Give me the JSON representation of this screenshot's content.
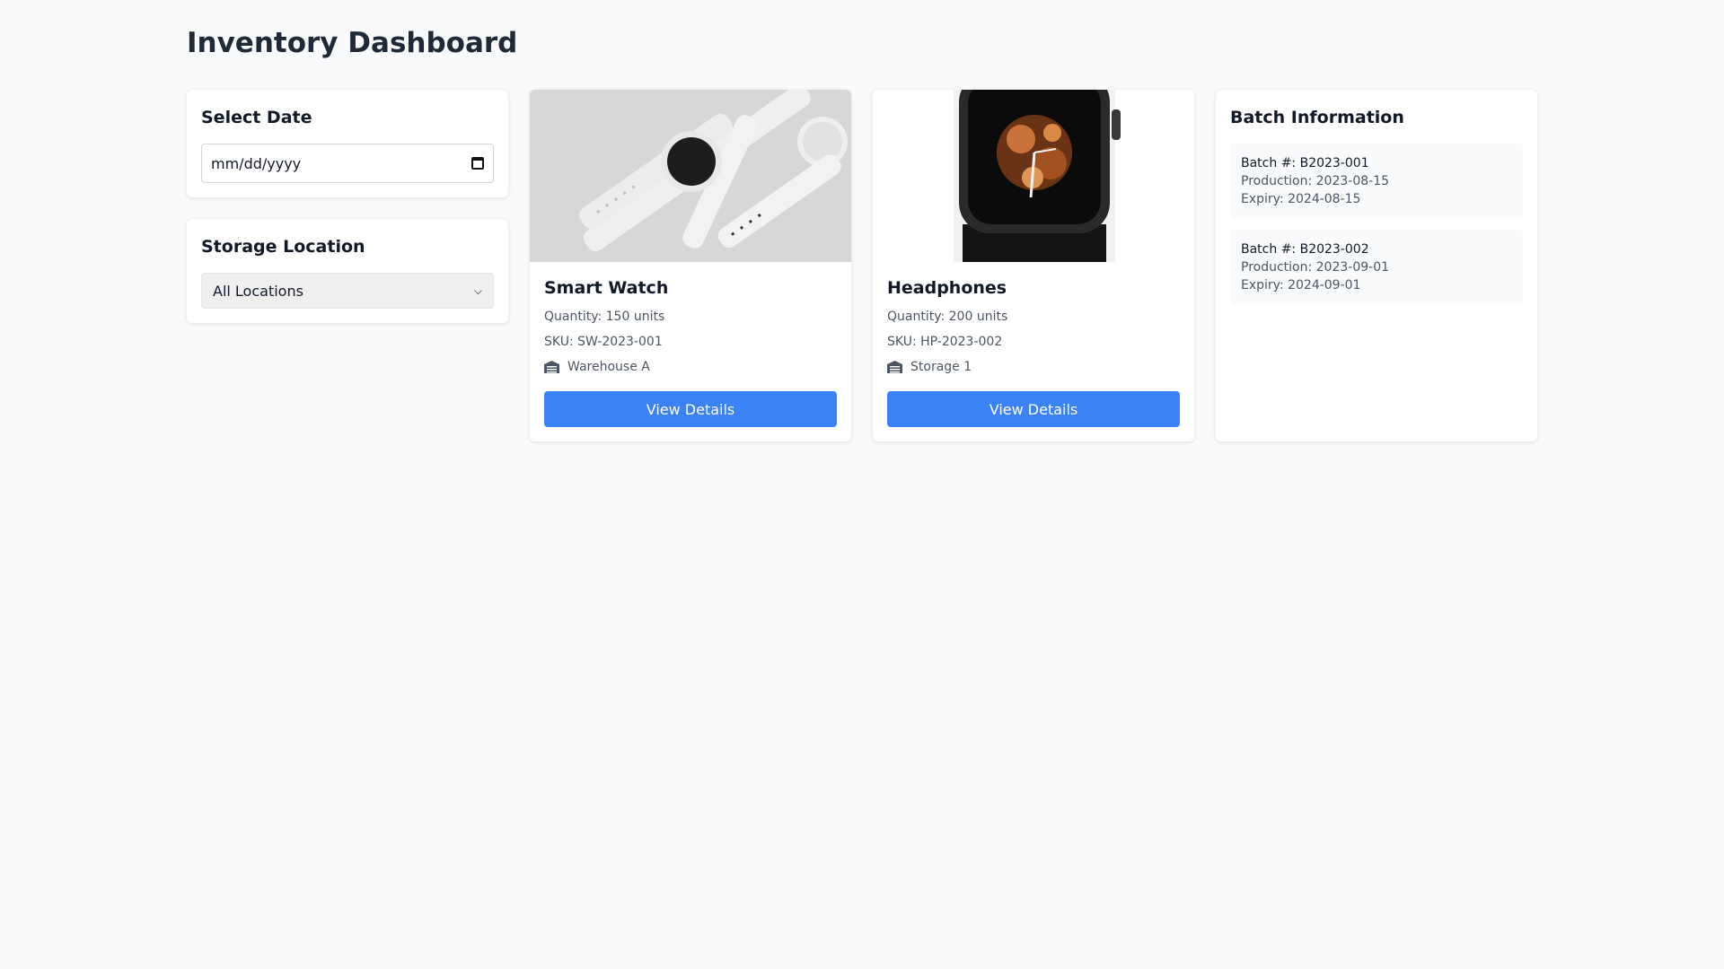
{
  "page": {
    "title": "Inventory Dashboard"
  },
  "date_filter": {
    "title": "Select Date",
    "placeholder": "mm/dd/yyyy"
  },
  "location_filter": {
    "title": "Storage Location",
    "selected": "All Locations"
  },
  "products": [
    {
      "name": "Smart Watch",
      "quantity": "Quantity: 150 units",
      "sku": "SKU: SW-2023-001",
      "location": "Warehouse A",
      "button_label": "View Details",
      "location_icon": "warehouse-icon"
    },
    {
      "name": "Headphones",
      "quantity": "Quantity: 200 units",
      "sku": "SKU: HP-2023-002",
      "location": "Storage 1",
      "button_label": "View Details",
      "location_icon": "warehouse-icon"
    }
  ],
  "batch_info": {
    "title": "Batch Information",
    "batches": [
      {
        "number": "Batch #: B2023-001",
        "production": "Production: 2023-08-15",
        "expiry": "Expiry: 2024-08-15"
      },
      {
        "number": "Batch #: B2023-002",
        "production": "Production: 2023-09-01",
        "expiry": "Expiry: 2024-09-01"
      }
    ]
  },
  "colors": {
    "accent": "#3b82f6",
    "background": "#f8fafc"
  }
}
